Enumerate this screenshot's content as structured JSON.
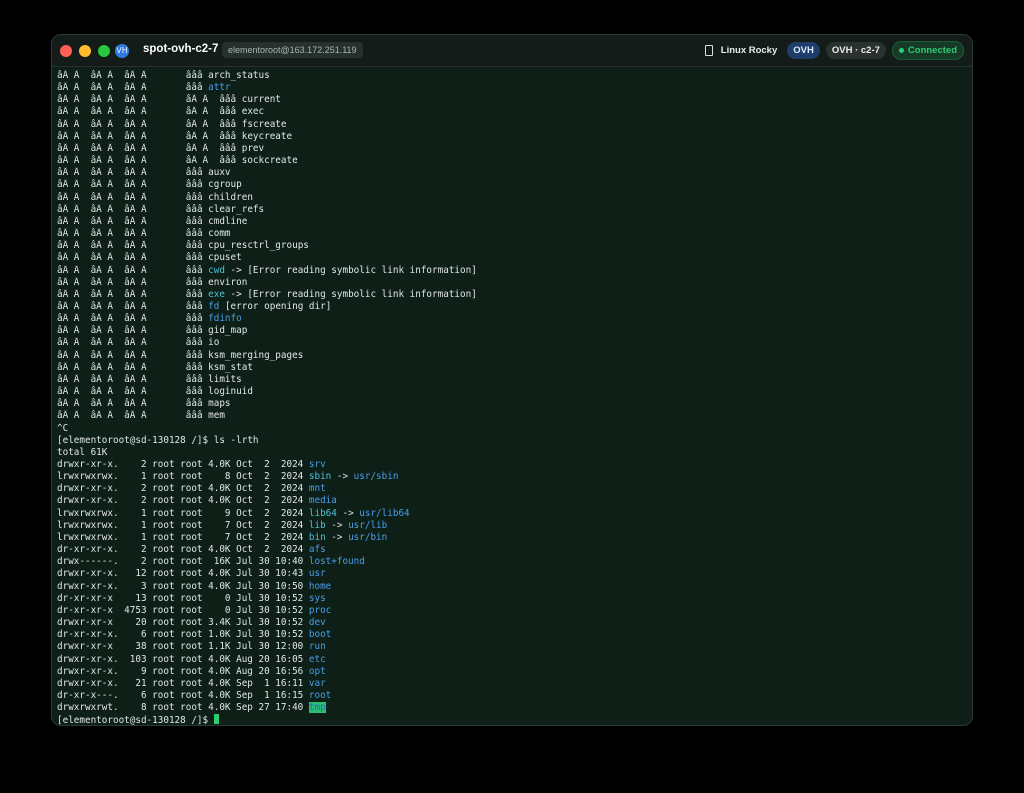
{
  "window": {
    "title": "spot-ovh-c2-7",
    "host": "elementoroot@163.172.251.119",
    "app_icon_glyph": "VH",
    "os_label": "Linux Rocky",
    "provider_badge": "OVH",
    "region_badge": "OVH · c2-7",
    "status": "Connected",
    "colors": {
      "status": "#2ecc71",
      "provider": "#1e3d6b",
      "dir": "#4a9ee8",
      "link": "#4ec2d8"
    }
  },
  "tree_lines": [
    {
      "prefix": "âÂ Â  âÂ Â  âÂ Â       ",
      "name": "âââ arch_status",
      "kind": "file"
    },
    {
      "prefix": "âÂ Â  âÂ Â  âÂ Â       ",
      "name": "âââ ",
      "target": "attr",
      "kind": "dir"
    },
    {
      "prefix": "âÂ Â  âÂ Â  âÂ Â       ",
      "name": "âÂ Â  âââ current",
      "kind": "file"
    },
    {
      "prefix": "âÂ Â  âÂ Â  âÂ Â       ",
      "name": "âÂ Â  âââ exec",
      "kind": "file"
    },
    {
      "prefix": "âÂ Â  âÂ Â  âÂ Â       ",
      "name": "âÂ Â  âââ fscreate",
      "kind": "file"
    },
    {
      "prefix": "âÂ Â  âÂ Â  âÂ Â       ",
      "name": "âÂ Â  âââ keycreate",
      "kind": "file"
    },
    {
      "prefix": "âÂ Â  âÂ Â  âÂ Â       ",
      "name": "âÂ Â  âââ prev",
      "kind": "file"
    },
    {
      "prefix": "âÂ Â  âÂ Â  âÂ Â       ",
      "name": "âÂ Â  âââ sockcreate",
      "kind": "file"
    },
    {
      "prefix": "âÂ Â  âÂ Â  âÂ Â       ",
      "name": "âââ auxv",
      "kind": "file"
    },
    {
      "prefix": "âÂ Â  âÂ Â  âÂ Â       ",
      "name": "âââ cgroup",
      "kind": "file"
    },
    {
      "prefix": "âÂ Â  âÂ Â  âÂ Â       ",
      "name": "âââ children",
      "kind": "file"
    },
    {
      "prefix": "âÂ Â  âÂ Â  âÂ Â       ",
      "name": "âââ clear_refs",
      "kind": "file"
    },
    {
      "prefix": "âÂ Â  âÂ Â  âÂ Â       ",
      "name": "âââ cmdline",
      "kind": "file"
    },
    {
      "prefix": "âÂ Â  âÂ Â  âÂ Â       ",
      "name": "âââ comm",
      "kind": "file"
    },
    {
      "prefix": "âÂ Â  âÂ Â  âÂ Â       ",
      "name": "âââ cpu_resctrl_groups",
      "kind": "file"
    },
    {
      "prefix": "âÂ Â  âÂ Â  âÂ Â       ",
      "name": "âââ cpuset",
      "kind": "file"
    },
    {
      "prefix": "âÂ Â  âÂ Â  âÂ Â       ",
      "name": "âââ ",
      "target": "cwd",
      "rest": " -> [Error reading symbolic link information]",
      "kind": "link"
    },
    {
      "prefix": "âÂ Â  âÂ Â  âÂ Â       ",
      "name": "âââ environ",
      "kind": "file"
    },
    {
      "prefix": "âÂ Â  âÂ Â  âÂ Â       ",
      "name": "âââ ",
      "target": "exe",
      "rest": " -> [Error reading symbolic link information]",
      "kind": "link"
    },
    {
      "prefix": "âÂ Â  âÂ Â  âÂ Â       ",
      "name": "âââ ",
      "target": "fd",
      "rest": " [error opening dir]",
      "kind": "dir"
    },
    {
      "prefix": "âÂ Â  âÂ Â  âÂ Â       ",
      "name": "âââ ",
      "target": "fdinfo",
      "kind": "dir"
    },
    {
      "prefix": "âÂ Â  âÂ Â  âÂ Â       ",
      "name": "âââ gid_map",
      "kind": "file"
    },
    {
      "prefix": "âÂ Â  âÂ Â  âÂ Â       ",
      "name": "âââ io",
      "kind": "file"
    },
    {
      "prefix": "âÂ Â  âÂ Â  âÂ Â       ",
      "name": "âââ ksm_merging_pages",
      "kind": "file"
    },
    {
      "prefix": "âÂ Â  âÂ Â  âÂ Â       ",
      "name": "âââ ksm_stat",
      "kind": "file"
    },
    {
      "prefix": "âÂ Â  âÂ Â  âÂ Â       ",
      "name": "âââ limits",
      "kind": "file"
    },
    {
      "prefix": "âÂ Â  âÂ Â  âÂ Â       ",
      "name": "âââ loginuid",
      "kind": "file"
    },
    {
      "prefix": "âÂ Â  âÂ Â  âÂ Â       ",
      "name": "âââ maps",
      "kind": "file"
    },
    {
      "prefix": "âÂ Â  âÂ Â  âÂ Â       ",
      "name": "âââ mem",
      "kind": "file"
    }
  ],
  "interrupt": "^C",
  "prompt": "[elementoroot@sd-130128 /]$ ",
  "command": "ls -lrth",
  "total": "total 61K",
  "listing": [
    {
      "meta": "drwxr-xr-x.    2 root root 4.0K Oct  2  2024 ",
      "name": "srv",
      "kind": "dir"
    },
    {
      "meta": "lrwxrwxrwx.    1 root root    8 Oct  2  2024 ",
      "name": "sbin",
      "arrow": " -> ",
      "target": "usr/sbin",
      "kind": "link"
    },
    {
      "meta": "drwxr-xr-x.    2 root root 4.0K Oct  2  2024 ",
      "name": "mnt",
      "kind": "dir"
    },
    {
      "meta": "drwxr-xr-x.    2 root root 4.0K Oct  2  2024 ",
      "name": "media",
      "kind": "dir"
    },
    {
      "meta": "lrwxrwxrwx.    1 root root    9 Oct  2  2024 ",
      "name": "lib64",
      "arrow": " -> ",
      "target": "usr/lib64",
      "kind": "link"
    },
    {
      "meta": "lrwxrwxrwx.    1 root root    7 Oct  2  2024 ",
      "name": "lib",
      "arrow": " -> ",
      "target": "usr/lib",
      "kind": "link"
    },
    {
      "meta": "lrwxrwxrwx.    1 root root    7 Oct  2  2024 ",
      "name": "bin",
      "arrow": " -> ",
      "target": "usr/bin",
      "kind": "link"
    },
    {
      "meta": "dr-xr-xr-x.    2 root root 4.0K Oct  2  2024 ",
      "name": "afs",
      "kind": "dir"
    },
    {
      "meta": "drwx------.    2 root root  16K Jul 30 10:40 ",
      "name": "lost+found",
      "kind": "dir"
    },
    {
      "meta": "drwxr-xr-x.   12 root root 4.0K Jul 30 10:43 ",
      "name": "usr",
      "kind": "dir"
    },
    {
      "meta": "drwxr-xr-x.    3 root root 4.0K Jul 30 10:50 ",
      "name": "home",
      "kind": "dir"
    },
    {
      "meta": "dr-xr-xr-x    13 root root    0 Jul 30 10:52 ",
      "name": "sys",
      "kind": "dir"
    },
    {
      "meta": "dr-xr-xr-x  4753 root root    0 Jul 30 10:52 ",
      "name": "proc",
      "kind": "dir"
    },
    {
      "meta": "drwxr-xr-x    20 root root 3.4K Jul 30 10:52 ",
      "name": "dev",
      "kind": "dir"
    },
    {
      "meta": "dr-xr-xr-x.    6 root root 1.0K Jul 30 10:52 ",
      "name": "boot",
      "kind": "dir"
    },
    {
      "meta": "drwxr-xr-x    38 root root 1.1K Jul 30 12:00 ",
      "name": "run",
      "kind": "dir"
    },
    {
      "meta": "drwxr-xr-x.  103 root root 4.0K Aug 20 16:05 ",
      "name": "etc",
      "kind": "dir"
    },
    {
      "meta": "drwxr-xr-x.    9 root root 4.0K Aug 20 16:56 ",
      "name": "opt",
      "kind": "dir"
    },
    {
      "meta": "drwxr-xr-x.   21 root root 4.0K Sep  1 16:11 ",
      "name": "var",
      "kind": "dir"
    },
    {
      "meta": "dr-xr-x---.    6 root root 4.0K Sep  1 16:15 ",
      "name": "root",
      "kind": "dir"
    },
    {
      "meta": "drwxrwxrwt.    8 root root 4.0K Sep 27 17:40 ",
      "name": "tmp",
      "kind": "sticky"
    }
  ],
  "final_prompt": "[elementoroot@sd-130128 /]$ "
}
